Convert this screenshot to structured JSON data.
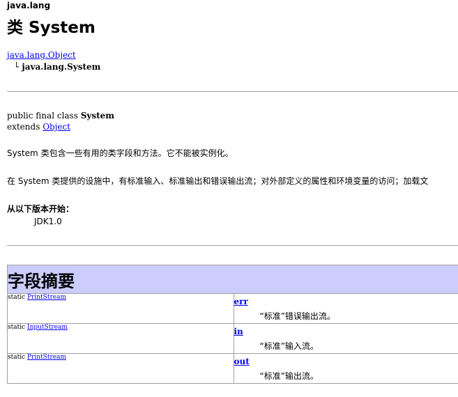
{
  "package": "java.lang",
  "title": "类 System",
  "hierarchy": {
    "parent": "java.lang.Object",
    "branch": "└",
    "child": "java.lang.System"
  },
  "declaration": {
    "prefix": "public final class ",
    "name": "System",
    "extends_label": "extends ",
    "extends_link": "Object"
  },
  "description": {
    "line1": "System 类包含一些有用的类字段和方法。它不能被实例化。",
    "line2": "在 System 类提供的设施中，有标准输入、标准输出和错误输出流；对外部定义的属性和环境变量的访问；加载文"
  },
  "since": {
    "label": "从以下版本开始：",
    "value": "JDK1.0"
  },
  "field_summary": {
    "heading": "字段摘要",
    "rows": [
      {
        "modifier": "static",
        "type": "PrintStream",
        "name": "err",
        "desc": "“标准”错误输出流。"
      },
      {
        "modifier": "static",
        "type": "InputStream",
        "name": "in",
        "desc": "“标准”输入流。"
      },
      {
        "modifier": "static",
        "type": "PrintStream",
        "name": "out",
        "desc": "“标准”输出流。"
      }
    ]
  },
  "colors": {
    "link": "#0000ee",
    "table_header_bg": "#ccccff",
    "rule": "#a0a0a0"
  }
}
